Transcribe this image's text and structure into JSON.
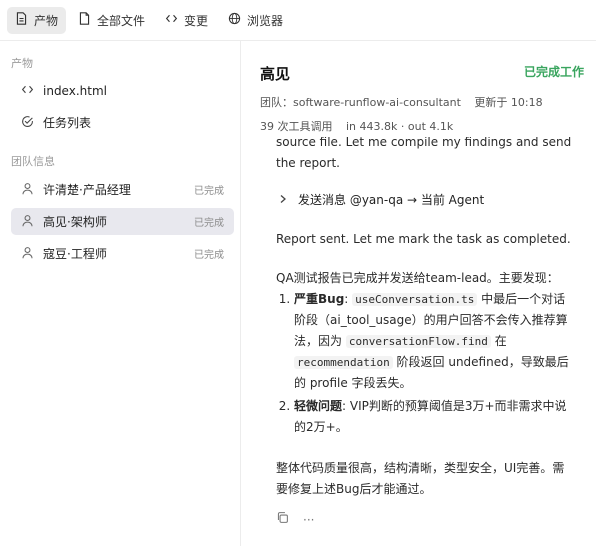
{
  "tabs": [
    {
      "label": "产物",
      "icon": "file-icon",
      "active": true
    },
    {
      "label": "全部文件",
      "icon": "file-outline-icon"
    },
    {
      "label": "变更",
      "icon": "code-icon"
    },
    {
      "label": "浏览器",
      "icon": "globe-icon"
    }
  ],
  "sidebar": {
    "artifacts_title": "产物",
    "artifacts": [
      {
        "label": "index.html",
        "icon": "code-icon"
      },
      {
        "label": "任务列表",
        "icon": "check-circle-icon"
      }
    ],
    "team_title": "团队信息",
    "team": [
      {
        "label": "许清楚·产品经理",
        "status": "已完成"
      },
      {
        "label": "高见·架构师",
        "status": "已完成",
        "selected": true
      },
      {
        "label": "寇豆·工程师",
        "status": "已完成"
      }
    ]
  },
  "main": {
    "title": "高见",
    "status": "已完成工作",
    "team_label": "团队：software-runflow-ai-consultant",
    "updated": "更新于 10:18",
    "tool_calls": "39 次工具调用",
    "tokens": "in 443.8k · out 4.1k",
    "para1": "source file. Let me compile my findings and send the report.",
    "tool_call": "发送消息 @yan-qa → 当前 Agent",
    "para2": "Report sent. Let me mark the task as completed.",
    "para3": "QA测试报告已完成并发送给team-lead。主要发现：",
    "item1": {
      "strong": "严重Bug",
      "colon": ": ",
      "code1": "useConversation.ts",
      "text1": " 中最后一个对话阶段（ai_tool_usage）的用户回答不会传入推荐算法，因为 ",
      "code2": "conversationFlow.find",
      "text2": " 在 ",
      "code3": "recommendation",
      "text3": " 阶段返回 undefined，导致最后的 profile 字段丢失。"
    },
    "item2": {
      "strong": "轻微问题",
      "text": ": VIP判断的预算阈值是3万+而非需求中说的2万+。"
    },
    "para4": "整体代码质量很高，结构清晰，类型安全，UI完善。需要修复上述Bug后才能通过。",
    "more": "···"
  },
  "colors": {
    "accent": "#3aa55f",
    "selected_bg": "#e8e8ee",
    "tab_active_bg": "#ebebeb"
  }
}
